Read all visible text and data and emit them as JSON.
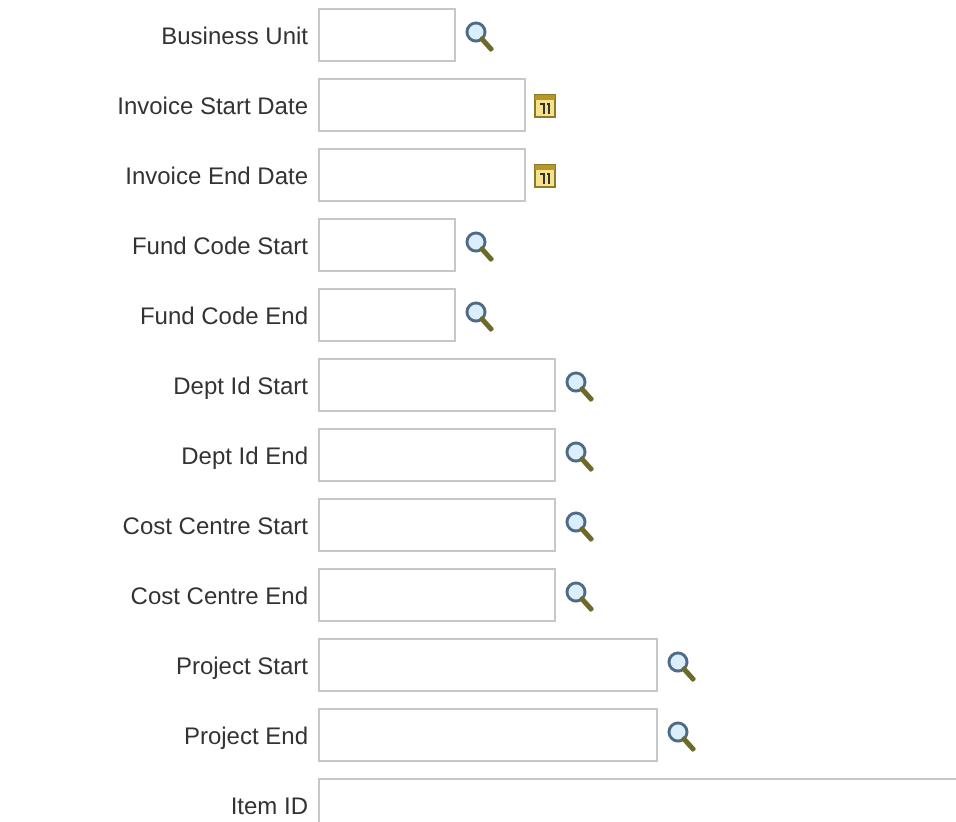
{
  "fields": [
    {
      "label": "Business Unit",
      "kind": "short"
    },
    {
      "label": "Invoice Start Date",
      "kind": "date"
    },
    {
      "label": "Invoice End Date",
      "kind": "date"
    },
    {
      "label": "Fund Code Start",
      "kind": "short"
    },
    {
      "label": "Fund Code End",
      "kind": "short"
    },
    {
      "label": "Dept Id Start",
      "kind": "medium"
    },
    {
      "label": "Dept Id End",
      "kind": "medium"
    },
    {
      "label": "Cost Centre Start",
      "kind": "medium"
    },
    {
      "label": "Cost Centre End",
      "kind": "medium"
    },
    {
      "label": "Project Start",
      "kind": "long"
    },
    {
      "label": "Project End",
      "kind": "long"
    },
    {
      "label": "Item ID",
      "kind": "plain"
    }
  ]
}
